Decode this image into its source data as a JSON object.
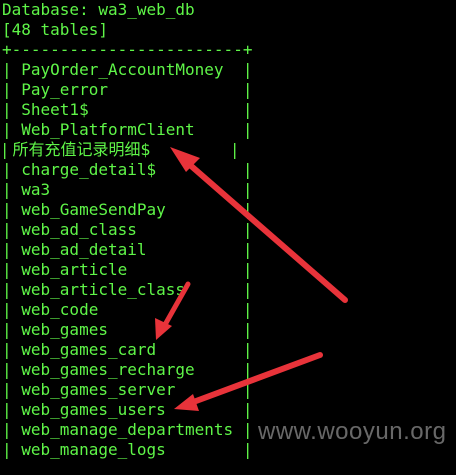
{
  "terminal": {
    "header_line": "Database: wa3_web_db",
    "count_line": "[48 tables]",
    "border_line": "+------------------------+",
    "rows": [
      "| PayOrder_AccountMoney  |",
      "| Pay_error              |",
      "| Sheet1$                |",
      "| Web_PlatformClient     |",
      "| 所有充值记录明细$                |",
      "| charge_detail$         |",
      "| wa3                    |",
      "| web_GameSendPay        |",
      "| web_ad_class           |",
      "| web_ad_detail          |",
      "| web_article            |",
      "| web_article_class      |",
      "| web_code               |",
      "| web_games              |",
      "| web_games_card         |",
      "| web_games_recharge     |",
      "| web_games_server       |",
      "| web_games_users        |",
      "| web_manage_departments |",
      "| web_manage_logs        |"
    ]
  },
  "watermark": "www.wooyun.org",
  "colors": {
    "background": "#000000",
    "terminal_text": "#5ff548",
    "arrow": "#e8333a"
  }
}
